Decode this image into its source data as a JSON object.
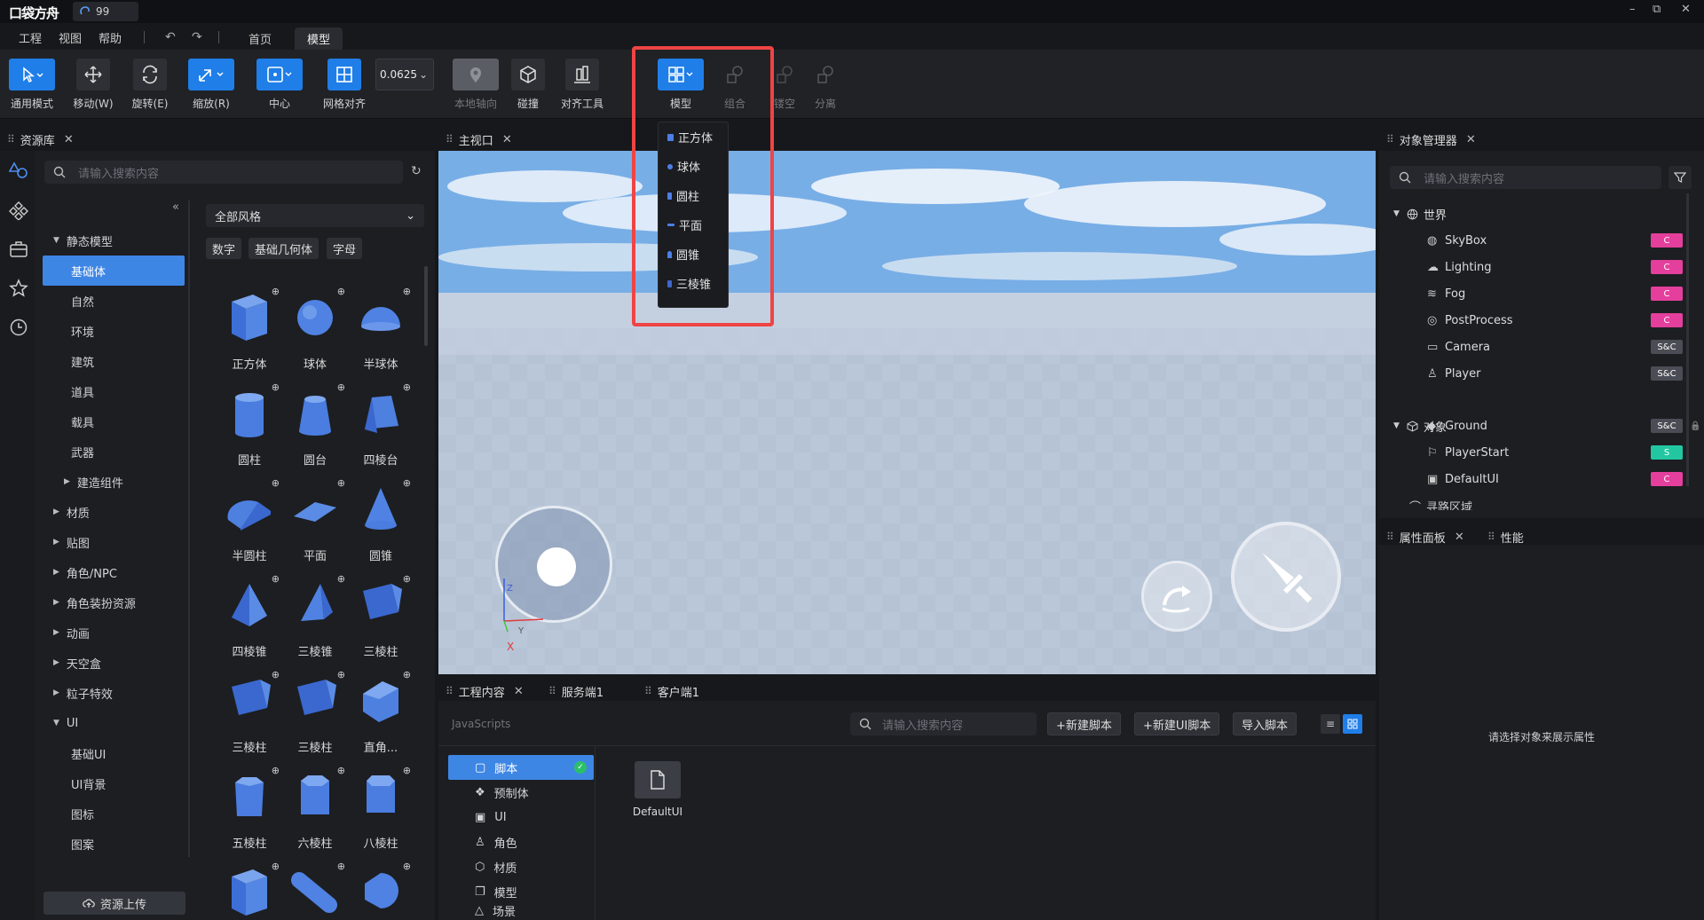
{
  "titlebar": {
    "logo": "口袋方舟",
    "tab_label": "99",
    "minimize": "–",
    "restore": "⧉",
    "close": "✕"
  },
  "menu": [
    "工程",
    "视图",
    "帮助"
  ],
  "top_tabs": [
    "首页",
    "模型"
  ],
  "toolbar": {
    "tools": [
      "通用模式",
      "移动(W)",
      "旋转(E)",
      "缩放(R)",
      "中心",
      "网格对齐",
      "本地轴向",
      "碰撞",
      "对齐工具",
      "模型",
      "组合",
      "镂空",
      "分离"
    ],
    "grid_value": "0.0625"
  },
  "model_dropdown": [
    "正方体",
    "球体",
    "圆柱",
    "平面",
    "圆锥",
    "三棱锥"
  ],
  "resource_panel": {
    "title": "资源库",
    "search_placeholder": "请输入搜索内容",
    "filter": "全部风格",
    "chips": [
      "数字",
      "基础几何体",
      "字母"
    ],
    "tree": [
      {
        "label": "静态模型",
        "level": 0,
        "arrow": "down"
      },
      {
        "label": "基础体",
        "level": 1,
        "selected": true
      },
      {
        "label": "自然",
        "level": 1
      },
      {
        "label": "环境",
        "level": 1
      },
      {
        "label": "建筑",
        "level": 1
      },
      {
        "label": "道具",
        "level": 1
      },
      {
        "label": "载具",
        "level": 1
      },
      {
        "label": "武器",
        "level": 1
      },
      {
        "label": "建造组件",
        "level": 1,
        "arrow": "right"
      },
      {
        "label": "材质",
        "level": 0,
        "arrow": "right"
      },
      {
        "label": "贴图",
        "level": 0,
        "arrow": "right"
      },
      {
        "label": "角色/NPC",
        "level": 0,
        "arrow": "right"
      },
      {
        "label": "角色装扮资源",
        "level": 0,
        "arrow": "right"
      },
      {
        "label": "动画",
        "level": 0,
        "arrow": "right"
      },
      {
        "label": "天空盒",
        "level": 0,
        "arrow": "right"
      },
      {
        "label": "粒子特效",
        "level": 0,
        "arrow": "right"
      },
      {
        "label": "UI",
        "level": 0,
        "arrow": "down"
      },
      {
        "label": "基础UI",
        "level": 1
      },
      {
        "label": "UI背景",
        "level": 1
      },
      {
        "label": "图标",
        "level": 1
      },
      {
        "label": "图案",
        "level": 1
      }
    ],
    "assets": [
      "正方体",
      "球体",
      "半球体",
      "圆柱",
      "圆台",
      "四棱台",
      "半圆柱",
      "平面",
      "圆锥",
      "四棱锥",
      "三棱锥",
      "三棱柱",
      "三棱柱",
      "三棱柱",
      "直角...",
      "五棱柱",
      "六棱柱",
      "八棱柱",
      "",
      "",
      ""
    ],
    "upload_button": "资源上传"
  },
  "viewport": {
    "title": "主视口",
    "axis_x": "X",
    "axis_y": "Y",
    "axis_z": "Z"
  },
  "object_manager": {
    "title": "对象管理器",
    "search_placeholder": "请输入搜索内容",
    "world": "世界",
    "world_items": [
      {
        "name": "SkyBox",
        "tag": "C"
      },
      {
        "name": "Lighting",
        "tag": "C"
      },
      {
        "name": "Fog",
        "tag": "C"
      },
      {
        "name": "PostProcess",
        "tag": "C"
      },
      {
        "name": "Camera",
        "tag": "S&C"
      },
      {
        "name": "Player",
        "tag": "S&C"
      }
    ],
    "objects": "对象",
    "object_items": [
      {
        "name": "Ground",
        "tag": "S&C"
      },
      {
        "name": "PlayerStart",
        "tag": "S"
      },
      {
        "name": "DefaultUI",
        "tag": "C"
      }
    ],
    "partial": "寻路区域"
  },
  "properties": {
    "tab1": "属性面板",
    "tab2": "性能",
    "empty_message": "请选择对象来展示属性"
  },
  "bottom": {
    "tabs": [
      "工程内容",
      "服务端1",
      "客户端1"
    ],
    "section": "JavaScripts",
    "search_placeholder": "请输入搜索内容",
    "buttons": [
      "+新建脚本",
      "+新建UI脚本",
      "导入脚本"
    ],
    "project_items": [
      "脚本",
      "预制体",
      "UI",
      "角色",
      "材质",
      "模型",
      "场景"
    ],
    "file_name": "DefaultUI"
  },
  "colors": {
    "accent": "#1f7ee8",
    "highlight": "#ef4444",
    "tag_client": "#e43f9c",
    "tag_server": "#22c7a2"
  }
}
